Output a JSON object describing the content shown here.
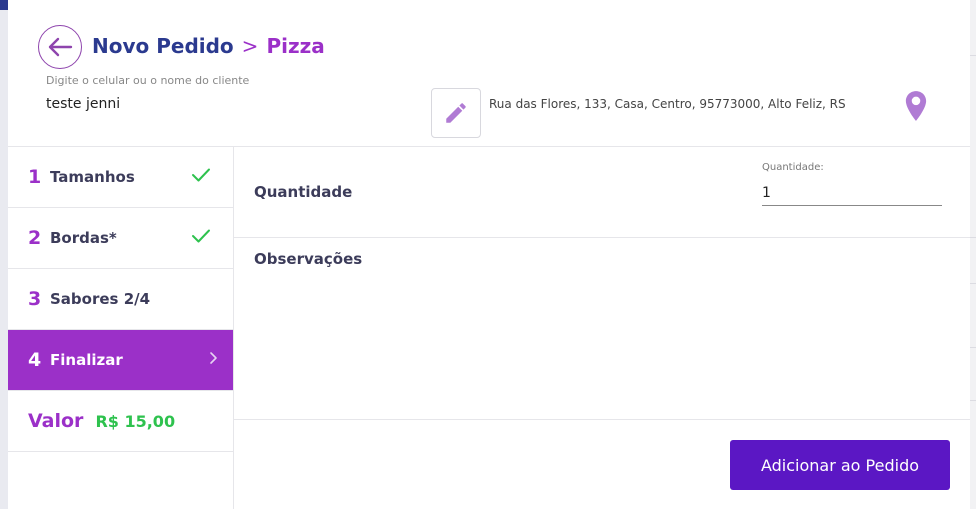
{
  "header": {
    "title": "Novo Pedido",
    "separator": ">",
    "subtitle": "Pizza",
    "client_label": "Digite o celular ou o nome do cliente",
    "client_value": "teste jenni",
    "address": "Rua das Flores, 133, Casa, Centro, 95773000, Alto Feliz, RS"
  },
  "steps": [
    {
      "num": "1",
      "label": "Tamanhos",
      "done": true
    },
    {
      "num": "2",
      "label": "Bordas*",
      "done": true
    },
    {
      "num": "3",
      "label": "Sabores 2/4",
      "done": false
    },
    {
      "num": "4",
      "label": "Finalizar",
      "active": true
    }
  ],
  "valor": {
    "label": "Valor",
    "amount": "R$ 15,00"
  },
  "content": {
    "qty_title": "Quantidade",
    "qty_label": "Quantidade:",
    "qty_value": "1",
    "obs_title": "Observações",
    "add_button": "Adicionar ao Pedido"
  },
  "colors": {
    "accent": "#9b30c8",
    "brand": "#2b3a8f",
    "success": "#2ec24e",
    "button": "#5b17c4"
  },
  "icons": {
    "back": "arrow-left-icon",
    "edit": "pencil-icon",
    "location": "map-pin-icon",
    "check": "check-icon",
    "chevron": "chevron-right-icon"
  }
}
